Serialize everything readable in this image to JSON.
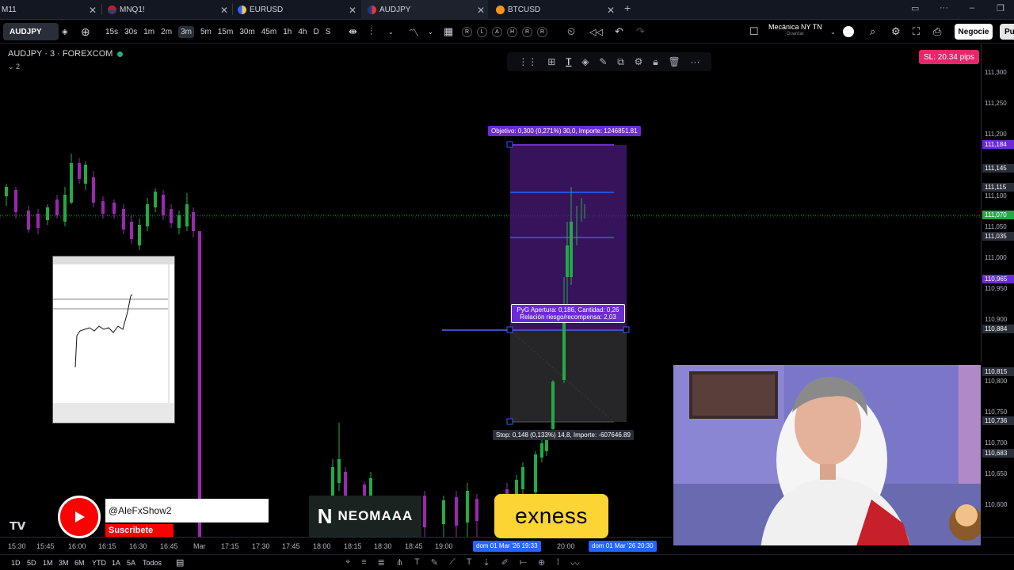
{
  "tabs": [
    {
      "label": "M11",
      "icon": "none"
    },
    {
      "label": "MNQ1!",
      "icon": "us-flag-icon"
    },
    {
      "label": "EURUSD",
      "icon": "currency-pair-icon"
    },
    {
      "label": "AUDJPY",
      "icon": "currency-pair-icon",
      "active": true
    },
    {
      "label": "BTCUSD",
      "icon": "bitcoin-icon"
    }
  ],
  "toolbar": {
    "symbol": "AUDJPY",
    "timeframes": [
      "15s",
      "30s",
      "1m",
      "2m",
      "3m",
      "5m",
      "15m",
      "30m",
      "45m",
      "1h",
      "4h",
      "D",
      "S"
    ],
    "active_timeframe": "3m",
    "replay_buttons": [
      "R",
      "L",
      "A",
      "H",
      "R",
      "R"
    ],
    "layout_name": "Mecánica NY TN",
    "layout_sub": "Guardar",
    "trade_button": "Negocie",
    "publish_button": "Pu"
  },
  "chart": {
    "title": "AUDJPY · 3 · FOREXCOM",
    "indicator_count": "2",
    "sl_badge": "SL: 20.34 pips",
    "target_label": "Objetivo: 0,300 (0,271%) 30,0, Importe: 1246851.81",
    "pnl_label_line1": "PyG Apertura: 0,186, Cantidad: 0,26",
    "pnl_label_line2": "Relación riesgo/recompensa: 2,03",
    "stop_label": "Stop: 0,148 (0,133%) 14,8, Importe: -607646.89",
    "price_labels": [
      "111,300",
      "111,250",
      "111,200",
      "111,100",
      "111,050",
      "111,000",
      "110,950",
      "110,900",
      "110,800",
      "110,750",
      "110,700",
      "110,650",
      "110,600"
    ],
    "price_tags": [
      {
        "text": "111,184",
        "color": "#6c2bd9"
      },
      {
        "text": "111,145",
        "color": "#2a2e39"
      },
      {
        "text": "111,115",
        "color": "#2a2e39"
      },
      {
        "text": "111,070",
        "color": "#22ab44"
      },
      {
        "text": "111,035",
        "color": "#2a2e39"
      },
      {
        "text": "110,965",
        "color": "#6c2bd9"
      },
      {
        "text": "110,884",
        "color": "#2a2e39"
      },
      {
        "text": "110,815",
        "color": "#2a2e39"
      },
      {
        "text": "110,736",
        "color": "#2a2e39"
      },
      {
        "text": "110,683",
        "color": "#2a2e39"
      }
    ]
  },
  "time_axis": {
    "labels": [
      "15:30",
      "15:45",
      "16:00",
      "16:15",
      "16:30",
      "16:45",
      "Mar",
      "17:15",
      "17:30",
      "17:45",
      "18:00",
      "18:15",
      "18:30",
      "18:45",
      "19:00",
      "20:00"
    ],
    "highlight_start": "dom 01 Mar '26  19:33",
    "highlight_end": "dom 01 Mar '26  20:30"
  },
  "bottom_bar": {
    "ranges": [
      "1D",
      "5D",
      "1M",
      "3M",
      "6M",
      "YTD",
      "1A",
      "5A",
      "Todos"
    ]
  },
  "overlays": {
    "youtube_handle": "@AleFxShow2",
    "youtube_subscribe": "Suscribete",
    "sponsor1": "NEOMAAA",
    "sponsor2": "exness"
  },
  "colors": {
    "bull": "#22ab44",
    "bear": "#9c27b0",
    "position_purple": "#6c2bd9",
    "sl_pink": "#e5266a",
    "exness_yellow": "#fcd535"
  }
}
